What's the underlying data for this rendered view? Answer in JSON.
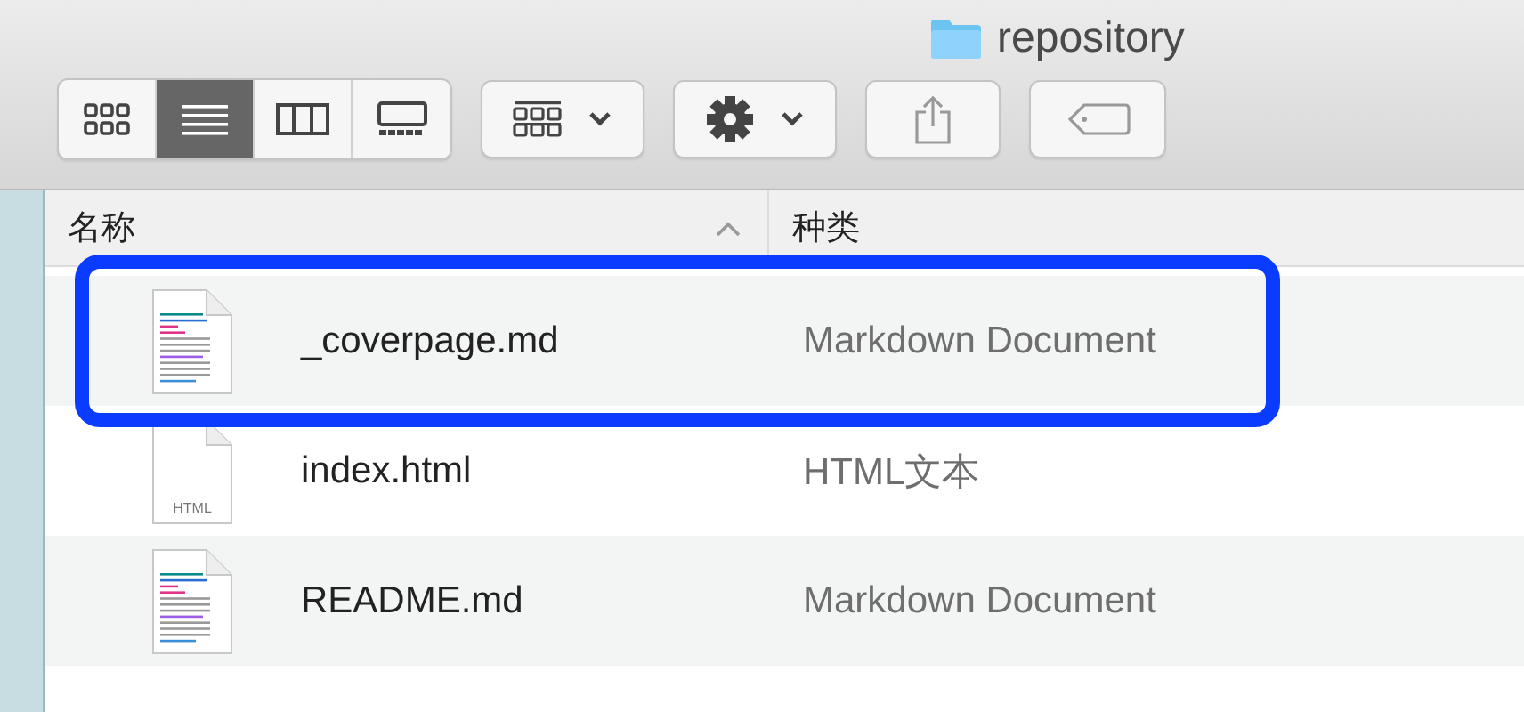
{
  "window": {
    "title": "repository"
  },
  "toolbar": {
    "view_buttons": [
      {
        "kind": "icons",
        "selected": false
      },
      {
        "kind": "list",
        "selected": true
      },
      {
        "kind": "columns",
        "selected": false
      },
      {
        "kind": "gallery",
        "selected": false
      }
    ]
  },
  "table": {
    "columns": [
      {
        "label": "名称",
        "sorted": true
      },
      {
        "label": "种类",
        "sorted": false
      }
    ],
    "rows": [
      {
        "name": "_coverpage.md",
        "type": "Markdown Document",
        "kind": "markdown",
        "highlighted": true
      },
      {
        "name": "index.html",
        "type": "HTML文本",
        "kind": "html",
        "icon_label": "HTML",
        "highlighted": false
      },
      {
        "name": "README.md",
        "type": "Markdown Document",
        "kind": "markdown",
        "highlighted": false
      }
    ]
  }
}
